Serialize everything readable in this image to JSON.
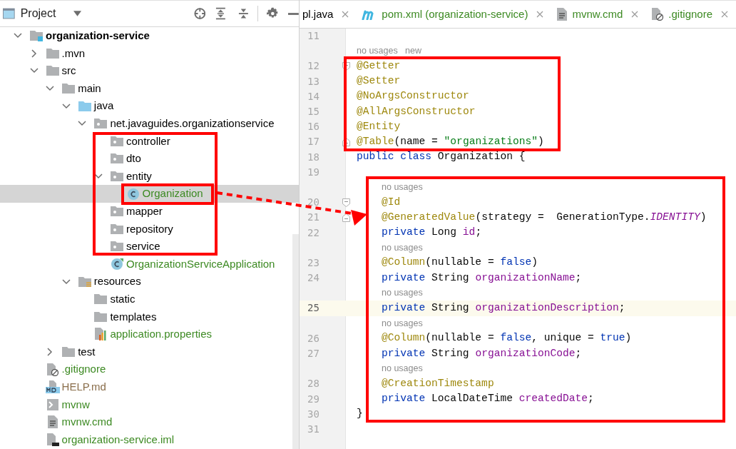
{
  "project_panel": {
    "title": "Project",
    "tree": [
      {
        "label": "organization-service",
        "kind": "module-root",
        "color": "#000000",
        "selected": false,
        "expanded": true,
        "children": [
          {
            "label": ".mvn",
            "kind": "folder",
            "color": "#000000",
            "selected": false,
            "expanded": false
          },
          {
            "label": "src",
            "kind": "folder",
            "color": "#000000",
            "selected": false,
            "expanded": true,
            "children": [
              {
                "label": "main",
                "kind": "folder",
                "color": "#000000",
                "selected": false,
                "expanded": true,
                "children": [
                  {
                    "label": "java",
                    "kind": "source-folder",
                    "color": "#000000",
                    "selected": false,
                    "expanded": true,
                    "children": [
                      {
                        "label": "net.javaguides.organizationservice",
                        "kind": "package",
                        "color": "#000000",
                        "selected": false,
                        "expanded": true,
                        "children": [
                          {
                            "label": "controller",
                            "kind": "package",
                            "color": "#000000",
                            "selected": false
                          },
                          {
                            "label": "dto",
                            "kind": "package",
                            "color": "#000000",
                            "selected": false
                          },
                          {
                            "label": "entity",
                            "kind": "package",
                            "color": "#000000",
                            "selected": false,
                            "expanded": true,
                            "children": [
                              {
                                "label": "Organization",
                                "kind": "class",
                                "color": "#3d8a23",
                                "selected": true
                              }
                            ]
                          },
                          {
                            "label": "mapper",
                            "kind": "package",
                            "color": "#000000",
                            "selected": false
                          },
                          {
                            "label": "repository",
                            "kind": "package",
                            "color": "#000000",
                            "selected": false
                          },
                          {
                            "label": "service",
                            "kind": "package",
                            "color": "#000000",
                            "selected": false
                          },
                          {
                            "label": "OrganizationServiceApplication",
                            "kind": "spring-class",
                            "color": "#3d8a23",
                            "selected": false
                          }
                        ]
                      }
                    ]
                  },
                  {
                    "label": "resources",
                    "kind": "resources-folder",
                    "color": "#000000",
                    "selected": false,
                    "expanded": true,
                    "children": [
                      {
                        "label": "static",
                        "kind": "folder",
                        "color": "#000000",
                        "selected": false
                      },
                      {
                        "label": "templates",
                        "kind": "folder",
                        "color": "#000000",
                        "selected": false
                      },
                      {
                        "label": "application.properties",
                        "kind": "properties",
                        "color": "#3d8a23",
                        "selected": false
                      }
                    ]
                  }
                ]
              },
              {
                "label": "test",
                "kind": "folder",
                "color": "#000000",
                "selected": false,
                "expanded": false
              }
            ]
          },
          {
            "label": ".gitignore",
            "kind": "gitignore",
            "color": "#3d8a23",
            "selected": false
          },
          {
            "label": "HELP.md",
            "kind": "markdown",
            "color": "#8a6e4b",
            "selected": false
          },
          {
            "label": "mvnw",
            "kind": "script",
            "color": "#3d8a23",
            "selected": false
          },
          {
            "label": "mvnw.cmd",
            "kind": "text-file",
            "color": "#3d8a23",
            "selected": false
          },
          {
            "label": "organization-service.iml",
            "kind": "module-file",
            "color": "#3d8a23",
            "selected": false
          }
        ]
      }
    ]
  },
  "editor_tabs": [
    {
      "label": "pl.java",
      "kind": "none",
      "color": "#000000"
    },
    {
      "label": "pom.xml (organization-service)",
      "kind": "maven",
      "color": "#3d8a23"
    },
    {
      "label": "mvnw.cmd",
      "kind": "text-file",
      "color": "#3d8a23"
    },
    {
      "label": ".gitignore",
      "kind": "gitignore",
      "color": "#3d8a23"
    }
  ],
  "editor": {
    "lines": [
      {
        "kind": "code",
        "number": "11",
        "current": false,
        "fold_start": false,
        "fold_end": false
      },
      {
        "kind": "hint",
        "text": "no usages   new"
      },
      {
        "kind": "code",
        "number": "12",
        "current": false,
        "fold_start": true,
        "fold_end": false,
        "indent": false,
        "tokens": [
          {
            "text": "@Getter",
            "kind": "annotation"
          }
        ]
      },
      {
        "kind": "code",
        "number": "13",
        "current": false,
        "fold_start": false,
        "fold_end": false,
        "indent": false,
        "tokens": [
          {
            "text": "@Setter",
            "kind": "annotation"
          }
        ]
      },
      {
        "kind": "code",
        "number": "14",
        "current": false,
        "fold_start": false,
        "fold_end": false,
        "indent": false,
        "tokens": [
          {
            "text": "@NoArgsConstructor",
            "kind": "annotation"
          }
        ]
      },
      {
        "kind": "code",
        "number": "15",
        "current": false,
        "fold_start": false,
        "fold_end": false,
        "indent": false,
        "tokens": [
          {
            "text": "@AllArgsConstructor",
            "kind": "annotation"
          }
        ]
      },
      {
        "kind": "code",
        "number": "16",
        "current": false,
        "fold_start": false,
        "fold_end": false,
        "indent": false,
        "tokens": [
          {
            "text": "@Entity",
            "kind": "annotation"
          }
        ]
      },
      {
        "kind": "code",
        "number": "17",
        "current": false,
        "fold_start": false,
        "fold_end": true,
        "indent": false,
        "tokens": [
          {
            "text": "@Table",
            "kind": "annotation"
          },
          {
            "text": "(name = ",
            "kind": "plain"
          },
          {
            "text": "\"organizations\"",
            "kind": "string"
          },
          {
            "text": ")",
            "kind": "plain"
          }
        ]
      },
      {
        "kind": "code",
        "number": "18",
        "current": false,
        "fold_start": false,
        "fold_end": false,
        "indent": false,
        "tokens": [
          {
            "text": "public class ",
            "kind": "keyword"
          },
          {
            "text": "Organization {",
            "kind": "plain"
          }
        ]
      },
      {
        "kind": "code",
        "number": "19",
        "current": false,
        "fold_start": false,
        "fold_end": false
      },
      {
        "kind": "hint",
        "text": "no usages",
        "indent": true
      },
      {
        "kind": "code",
        "number": "20",
        "current": false,
        "fold_start": true,
        "fold_end": false,
        "indent": true,
        "tokens": [
          {
            "text": "@Id",
            "kind": "annotation"
          }
        ]
      },
      {
        "kind": "code",
        "number": "21",
        "current": false,
        "fold_start": false,
        "fold_end": true,
        "indent": true,
        "tokens": [
          {
            "text": "@GeneratedValue",
            "kind": "annotation"
          },
          {
            "text": "(strategy =  GenerationType.",
            "kind": "plain"
          },
          {
            "text": "IDENTITY",
            "kind": "constant"
          },
          {
            "text": ")",
            "kind": "plain"
          }
        ]
      },
      {
        "kind": "code",
        "number": "22",
        "current": false,
        "fold_start": false,
        "fold_end": false,
        "indent": true,
        "tokens": [
          {
            "text": "private ",
            "kind": "keyword"
          },
          {
            "text": "Long ",
            "kind": "plain"
          },
          {
            "text": "id",
            "kind": "field"
          },
          {
            "text": ";",
            "kind": "plain"
          }
        ]
      },
      {
        "kind": "hint",
        "text": "no usages",
        "indent": true
      },
      {
        "kind": "code",
        "number": "23",
        "current": false,
        "fold_start": false,
        "fold_end": false,
        "indent": true,
        "tokens": [
          {
            "text": "@Column",
            "kind": "annotation"
          },
          {
            "text": "(nullable = ",
            "kind": "plain"
          },
          {
            "text": "false",
            "kind": "keyword"
          },
          {
            "text": ")",
            "kind": "plain"
          }
        ]
      },
      {
        "kind": "code",
        "number": "24",
        "current": false,
        "fold_start": false,
        "fold_end": false,
        "indent": true,
        "tokens": [
          {
            "text": "private ",
            "kind": "keyword"
          },
          {
            "text": "String ",
            "kind": "plain"
          },
          {
            "text": "organizationName",
            "kind": "field"
          },
          {
            "text": ";",
            "kind": "plain"
          }
        ]
      },
      {
        "kind": "hint",
        "text": "no usages",
        "indent": true
      },
      {
        "kind": "code",
        "number": "25",
        "current": true,
        "fold_start": false,
        "fold_end": false,
        "indent": true,
        "tokens": [
          {
            "text": "private ",
            "kind": "keyword"
          },
          {
            "text": "String ",
            "kind": "plain"
          },
          {
            "text": "organizationDescription",
            "kind": "field"
          },
          {
            "text": ";",
            "kind": "plain"
          }
        ]
      },
      {
        "kind": "hint",
        "text": "no usages",
        "indent": true
      },
      {
        "kind": "code",
        "number": "26",
        "current": false,
        "fold_start": false,
        "fold_end": false,
        "indent": true,
        "tokens": [
          {
            "text": "@Column",
            "kind": "annotation"
          },
          {
            "text": "(nullable = ",
            "kind": "plain"
          },
          {
            "text": "false",
            "kind": "keyword"
          },
          {
            "text": ", unique = ",
            "kind": "plain"
          },
          {
            "text": "true",
            "kind": "keyword"
          },
          {
            "text": ")",
            "kind": "plain"
          }
        ]
      },
      {
        "kind": "code",
        "number": "27",
        "current": false,
        "fold_start": false,
        "fold_end": false,
        "indent": true,
        "tokens": [
          {
            "text": "private ",
            "kind": "keyword"
          },
          {
            "text": "String ",
            "kind": "plain"
          },
          {
            "text": "organizationCode",
            "kind": "field"
          },
          {
            "text": ";",
            "kind": "plain"
          }
        ]
      },
      {
        "kind": "hint",
        "text": "no usages",
        "indent": true
      },
      {
        "kind": "code",
        "number": "28",
        "current": false,
        "fold_start": false,
        "fold_end": false,
        "indent": true,
        "tokens": [
          {
            "text": "@CreationTimestamp",
            "kind": "annotation"
          }
        ]
      },
      {
        "kind": "code",
        "number": "29",
        "current": false,
        "fold_start": false,
        "fold_end": false,
        "indent": true,
        "tokens": [
          {
            "text": "private ",
            "kind": "keyword"
          },
          {
            "text": "LocalDateTime ",
            "kind": "plain"
          },
          {
            "text": "createdDate",
            "kind": "field"
          },
          {
            "text": ";",
            "kind": "plain"
          }
        ]
      },
      {
        "kind": "code",
        "number": "30",
        "current": false,
        "fold_start": false,
        "fold_end": false,
        "indent": false,
        "tokens": [
          {
            "text": "}",
            "kind": "plain"
          }
        ]
      },
      {
        "kind": "code",
        "number": "31",
        "current": false,
        "fold_start": false,
        "fold_end": false
      }
    ]
  }
}
